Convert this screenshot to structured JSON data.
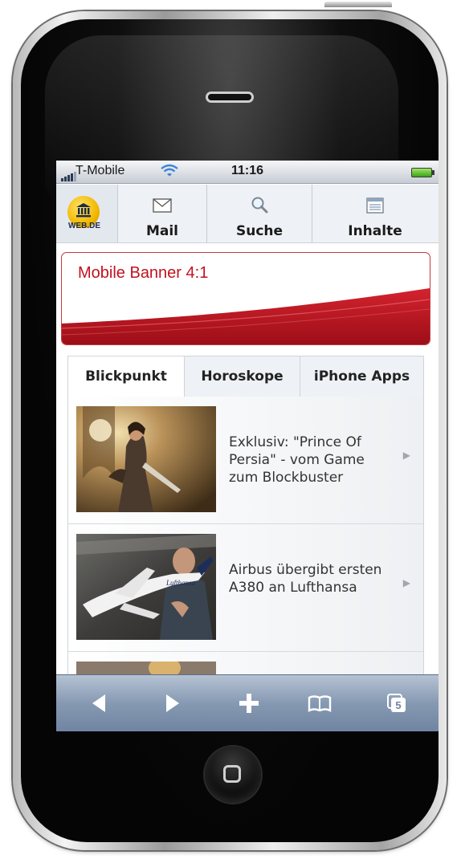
{
  "status_bar": {
    "carrier": "T-Mobile",
    "time": "11:16",
    "icons": [
      "signal-icon",
      "wifi-icon",
      "battery-icon"
    ]
  },
  "nav": {
    "logo_text": "WEB.DE",
    "tabs": [
      {
        "label": "Mail",
        "icon": "mail-icon"
      },
      {
        "label": "Suche",
        "icon": "search-icon"
      },
      {
        "label": "Inhalte",
        "icon": "contents-icon"
      }
    ]
  },
  "banner": {
    "text": "Mobile Banner 4:1",
    "accent_color": "#c1121f"
  },
  "content_tabs": [
    {
      "label": "Blickpunkt",
      "active": true
    },
    {
      "label": "Horoskope",
      "active": false
    },
    {
      "label": "iPhone Apps",
      "active": false
    }
  ],
  "news": [
    {
      "title": "Exklusiv: \"Prince Of Persia\" - vom Game zum Blockbuster"
    },
    {
      "title": "Airbus übergibt ersten A380 an Lufthansa"
    }
  ],
  "thumb_label": "Lufthansa",
  "toolbar": {
    "buttons": [
      "back-icon",
      "forward-icon",
      "add-bookmark-icon",
      "bookmarks-icon",
      "pages-icon"
    ],
    "pages_count": "5"
  }
}
